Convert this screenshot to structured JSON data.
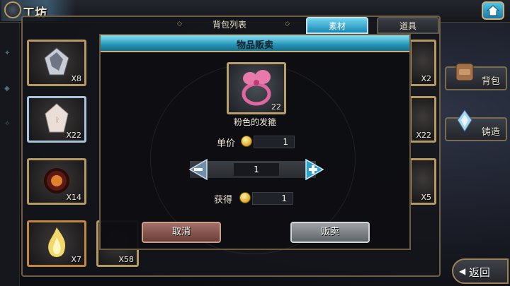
{
  "header": {
    "title": "工坊",
    "home_icon": "home-icon"
  },
  "tabs": {
    "list_label": "背包列表",
    "active": "素材",
    "inactive": "道具"
  },
  "grid": {
    "left": [
      {
        "count": "X8",
        "icon": "dark-crystal-icon",
        "frame": "gold"
      },
      {
        "count": "X22",
        "icon": "rune-stone-icon",
        "frame": "blue"
      },
      {
        "count": "X14",
        "icon": "fire-core-icon",
        "frame": "gold"
      },
      {
        "count": "X7",
        "icon": "flame-icon",
        "frame": "orange"
      }
    ],
    "second_col_count": "X58",
    "right": [
      {
        "count": "X2"
      },
      {
        "count": "X22"
      },
      {
        "count": "X5"
      }
    ]
  },
  "side": {
    "bag_label": "背包",
    "forge_label": "铸造"
  },
  "back": {
    "label": "返回"
  },
  "modal": {
    "title": "物品贩卖",
    "item_count": "22",
    "item_name": "粉色的发箍",
    "unit_price_label": "单价",
    "unit_price": "1",
    "quantity": "1",
    "gain_label": "获得",
    "gain": "1",
    "cancel_label": "取消",
    "sell_label": "贩卖"
  },
  "colors": {
    "accent": "#2595b8",
    "frame_gold": "#b59b63",
    "ribbon_pink": "#e0669f"
  }
}
